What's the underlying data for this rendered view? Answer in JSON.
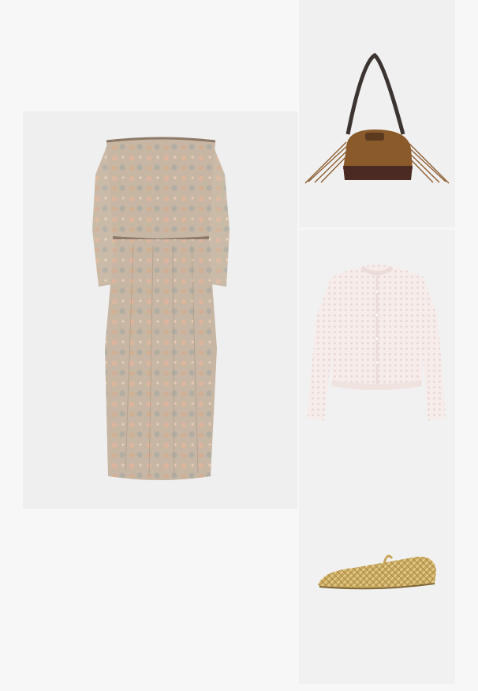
{
  "collage": {
    "items": [
      {
        "name": "dress",
        "description_icon": "paisley-off-shoulder-maxi-dress"
      },
      {
        "name": "bag",
        "description_icon": "suede-fringe-shoulder-bag"
      },
      {
        "name": "cardigan",
        "description_icon": "pointelle-knit-cardigan"
      },
      {
        "name": "flats",
        "description_icon": "gold-woven-ballet-flats"
      }
    ]
  },
  "colors": {
    "background": "#f7f7f7",
    "panel": "#efefef",
    "dress": "#c9b5a2",
    "bag_suede": "#8a5a2b",
    "cardigan": "#f4e9e8",
    "flats_gold": "#c9a960"
  }
}
